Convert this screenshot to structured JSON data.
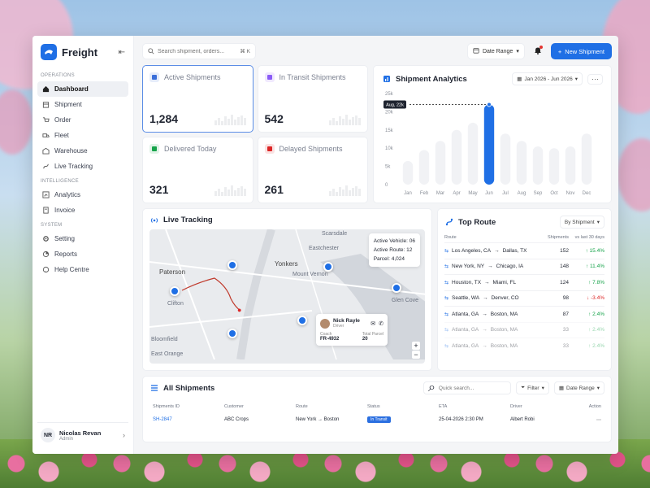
{
  "brand": {
    "name": "Freight"
  },
  "sidebar": {
    "sections": [
      {
        "label": "OPERATIONS",
        "items": [
          {
            "label": "Dashboard",
            "icon": "home-icon",
            "active": true
          },
          {
            "label": "Shipment",
            "icon": "box-icon"
          },
          {
            "label": "Order",
            "icon": "order-icon"
          },
          {
            "label": "Fleet",
            "icon": "truck-icon"
          },
          {
            "label": "Warehouse",
            "icon": "warehouse-icon"
          },
          {
            "label": "Live Tracking",
            "icon": "tracking-icon"
          }
        ]
      },
      {
        "label": "INTELLIGENCE",
        "items": [
          {
            "label": "Analytics",
            "icon": "analytics-icon"
          },
          {
            "label": "Invoice",
            "icon": "invoice-icon"
          }
        ]
      },
      {
        "label": "SYSTEM",
        "items": [
          {
            "label": "Setting",
            "icon": "gear-icon"
          },
          {
            "label": "Reports",
            "icon": "reports-icon"
          },
          {
            "label": "Help Centre",
            "icon": "help-icon"
          }
        ]
      }
    ],
    "user": {
      "initials": "NR",
      "name": "Nicolas Revan",
      "role": "Admin"
    }
  },
  "topbar": {
    "search_placeholder": "Search shipment, orders...",
    "shortcut": "⌘ K",
    "date_range": "Date Range",
    "new_button": "New Shipment"
  },
  "stats": [
    {
      "label": "Active Shipments",
      "value": "1,284",
      "color": "#3b6fd9"
    },
    {
      "label": "In Transit Shipments",
      "value": "542",
      "color": "#8b5cf6"
    },
    {
      "label": "Delivered Today",
      "value": "321",
      "color": "#16a34a"
    },
    {
      "label": "Delayed Shipments",
      "value": "261",
      "color": "#dc2626"
    }
  ],
  "analytics": {
    "title": "Shipment Analytics",
    "date_range": "Jan 2026 - Jun 2026",
    "tooltip": "Aug, 22k"
  },
  "chart_data": {
    "type": "bar",
    "categories": [
      "Jan",
      "Feb",
      "Mar",
      "Apr",
      "May",
      "Jun",
      "Jul",
      "Aug",
      "Sep",
      "Oct",
      "Nov",
      "Dec"
    ],
    "values": [
      6.5,
      9.5,
      12,
      15,
      17,
      22,
      14,
      12,
      10.5,
      10,
      10.5,
      14
    ],
    "highlight_index": 5,
    "yticks": [
      "0",
      "5k",
      "10k",
      "15k",
      "20k",
      "25k"
    ],
    "ylim": [
      0,
      25
    ],
    "highlight_color": "#1f6fe5",
    "bar_color": "#f1f2f5"
  },
  "tracking": {
    "title": "Live Tracking",
    "map_labels": [
      "Scarsdale",
      "Eastchester",
      "Paterson",
      "Yonkers",
      "Mount Vernon",
      "Clifton",
      "Bloomfield",
      "East Orange",
      "Glen Cove"
    ],
    "info": {
      "active_vehicle": "Active Vehicle: 06",
      "active_route": "Active Route: 12",
      "parcel": "Parcel: 4,024"
    },
    "driver": {
      "name": "Nick Rayle",
      "role": "Driver",
      "coach_label": "Coach",
      "coach_value": "FR-4932",
      "parcel_label": "Total Parcel",
      "parcel_value": "20"
    }
  },
  "top_route": {
    "title": "Top Route",
    "filter": "By Shipment",
    "columns": [
      "Route",
      "Shipments",
      "vs last 30 days"
    ],
    "rows": [
      {
        "from": "Los Angeles, CA",
        "to": "Dallas, TX",
        "shipments": "152",
        "change": "↑ 15.4%",
        "dir": "up"
      },
      {
        "from": "New York, NY",
        "to": "Chicago, IA",
        "shipments": "148",
        "change": "↑ 11.4%",
        "dir": "up"
      },
      {
        "from": "Houston, TX",
        "to": "Miami, FL",
        "shipments": "124",
        "change": "↑ 7.8%",
        "dir": "up"
      },
      {
        "from": "Seattle, WA",
        "to": "Denver, CO",
        "shipments": "98",
        "change": "↓ -3.4%",
        "dir": "down"
      },
      {
        "from": "Atlanta, GA",
        "to": "Boston, MA",
        "shipments": "87",
        "change": "↑ 2.4%",
        "dir": "up"
      },
      {
        "from": "Atlanta, GA",
        "to": "Boston, MA",
        "shipments": "33",
        "change": "↑ 2.4%",
        "dir": "up"
      },
      {
        "from": "Atlanta, GA",
        "to": "Boston, MA",
        "shipments": "33",
        "change": "↑ 2.4%",
        "dir": "up"
      }
    ]
  },
  "all_shipments": {
    "title": "All Shipments",
    "search_placeholder": "Quick search...",
    "filter": "Filter",
    "date_range": "Date Range",
    "columns": [
      "Shipments ID",
      "Customer",
      "Route",
      "Status",
      "ETA",
      "Driver",
      "Action"
    ],
    "rows": [
      {
        "id": "SH-2847",
        "customer": "ABC Crops",
        "route": "New York → Boston",
        "status": "In Transit",
        "eta": "25-04-2026  2:30 PM",
        "driver": "Albert Robi"
      }
    ]
  }
}
